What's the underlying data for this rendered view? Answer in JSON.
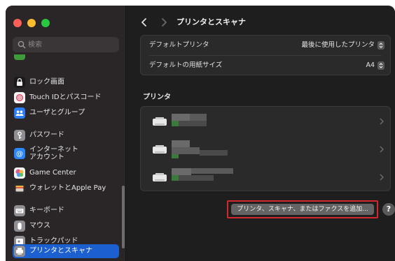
{
  "window": {
    "controls": {
      "close": "close",
      "minimize": "minimize",
      "zoom": "zoom"
    }
  },
  "sidebar": {
    "search": {
      "placeholder": "検索"
    },
    "items": [
      {
        "label": "ロック画面",
        "icon": "lock-icon"
      },
      {
        "label": "Touch IDとパスコード",
        "icon": "fingerprint-icon"
      },
      {
        "label": "ユーザとグループ",
        "icon": "users-icon"
      },
      {
        "label": "パスワード",
        "icon": "key-icon"
      },
      {
        "label": "インターネット\nアカウント",
        "icon": "at-icon"
      },
      {
        "label": "Game Center",
        "icon": "game-center-icon"
      },
      {
        "label": "ウォレットとApple Pay",
        "icon": "wallet-icon"
      },
      {
        "label": "キーボード",
        "icon": "keyboard-icon"
      },
      {
        "label": "マウス",
        "icon": "mouse-icon"
      },
      {
        "label": "トラックパッド",
        "icon": "trackpad-icon"
      },
      {
        "label": "プリンタとスキャナ",
        "icon": "printer-icon",
        "selected": true
      }
    ]
  },
  "main": {
    "title": "プリンタとスキャナ",
    "settings": [
      {
        "label": "デフォルトプリンタ",
        "value": "最後に使用したプリンタ"
      },
      {
        "label": "デフォルトの用紙サイズ",
        "value": "A4"
      }
    ],
    "printers_title": "プリンタ",
    "printers": [
      {
        "name": ""
      },
      {
        "name": ""
      },
      {
        "name": ""
      }
    ],
    "add_button_label": "プリンタ、スキャナ、またはファクスを追加...",
    "help_label": "?"
  },
  "colors": {
    "accent": "#1c5fcf",
    "highlight_box": "#d4282d"
  }
}
